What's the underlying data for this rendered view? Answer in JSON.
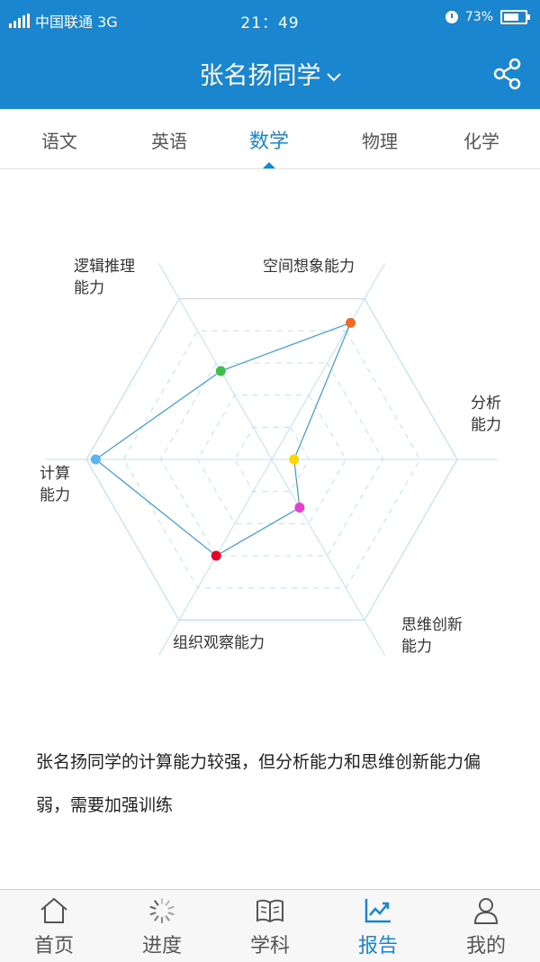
{
  "status": {
    "carrier": "中国联通 3G",
    "time": "21：49",
    "battery": "73%"
  },
  "header": {
    "title": "张名扬同学",
    "share_icon": "share-icon",
    "title_dropdown_icon": "chevron-down-icon"
  },
  "subject_tabs": [
    {
      "label": "语文",
      "active": false
    },
    {
      "label": "英语",
      "active": false
    },
    {
      "label": "数学",
      "active": true
    },
    {
      "label": "物理",
      "active": false
    },
    {
      "label": "化学",
      "active": false
    }
  ],
  "chart_data": {
    "type": "radar",
    "axes": [
      "空间想象能力",
      "分析能力",
      "思维创新能力",
      "组织观察能力",
      "计算能力",
      "逻辑推理能力"
    ],
    "axis_label_lines": [
      [
        "空间想象能力"
      ],
      [
        "分析",
        "能力"
      ],
      [
        "思维创新",
        "能力"
      ],
      [
        "组织观察能力"
      ],
      [
        "计算",
        "能力"
      ],
      [
        "逻辑推理",
        "能力"
      ]
    ],
    "values": [
      0.85,
      0.12,
      0.3,
      0.6,
      0.95,
      0.55
    ],
    "max": 1,
    "levels": 5,
    "point_colors": [
      "#ee6b20",
      "#ffd700",
      "#e43fd0",
      "#e8002a",
      "#5ab5f2",
      "#3dc04a"
    ],
    "line_color": "#3a9ad9",
    "grid_color": "#bfe0f3"
  },
  "summary": "张名扬同学的计算能力较强，但分析能力和思维创新能力偏弱，需要加强训练",
  "bottom_nav": [
    {
      "label": "首页",
      "icon": "home-icon",
      "active": false
    },
    {
      "label": "进度",
      "icon": "progress-spinner-icon",
      "active": false
    },
    {
      "label": "学科",
      "icon": "book-icon",
      "active": false
    },
    {
      "label": "报告",
      "icon": "chart-icon",
      "active": true
    },
    {
      "label": "我的",
      "icon": "user-icon",
      "active": false
    }
  ],
  "colors": {
    "primary": "#1a86d0",
    "background": "#ffffff"
  }
}
